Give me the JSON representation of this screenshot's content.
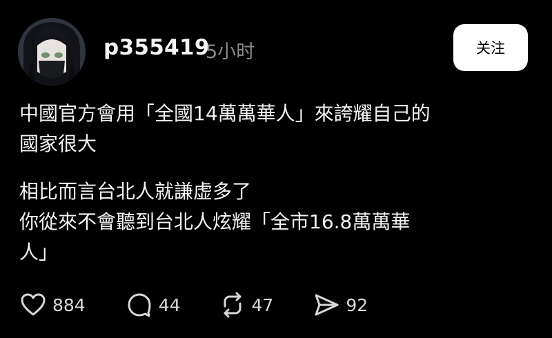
{
  "post": {
    "username": "p355419",
    "timestamp": "5小时",
    "follow_label": "关注",
    "paragraphs": [
      "中國官方會用「全國14萬萬華人」來誇耀自己的\n國家很大",
      "相比而言台北人就謙虚多了\n你從來不會聽到台北人炫耀「全市16.8萬萬華\n人」"
    ]
  },
  "actions": {
    "like": {
      "icon": "heart-icon",
      "count": "884"
    },
    "comment": {
      "icon": "comment-bubble-icon",
      "count": "44"
    },
    "repost": {
      "icon": "repost-icon",
      "count": "47"
    },
    "share": {
      "icon": "send-icon",
      "count": "92"
    }
  },
  "colors": {
    "background": "#000000",
    "text": "#f3f3f3",
    "muted": "#8a8a8a",
    "button_bg": "#ffffff",
    "button_text": "#000000"
  }
}
